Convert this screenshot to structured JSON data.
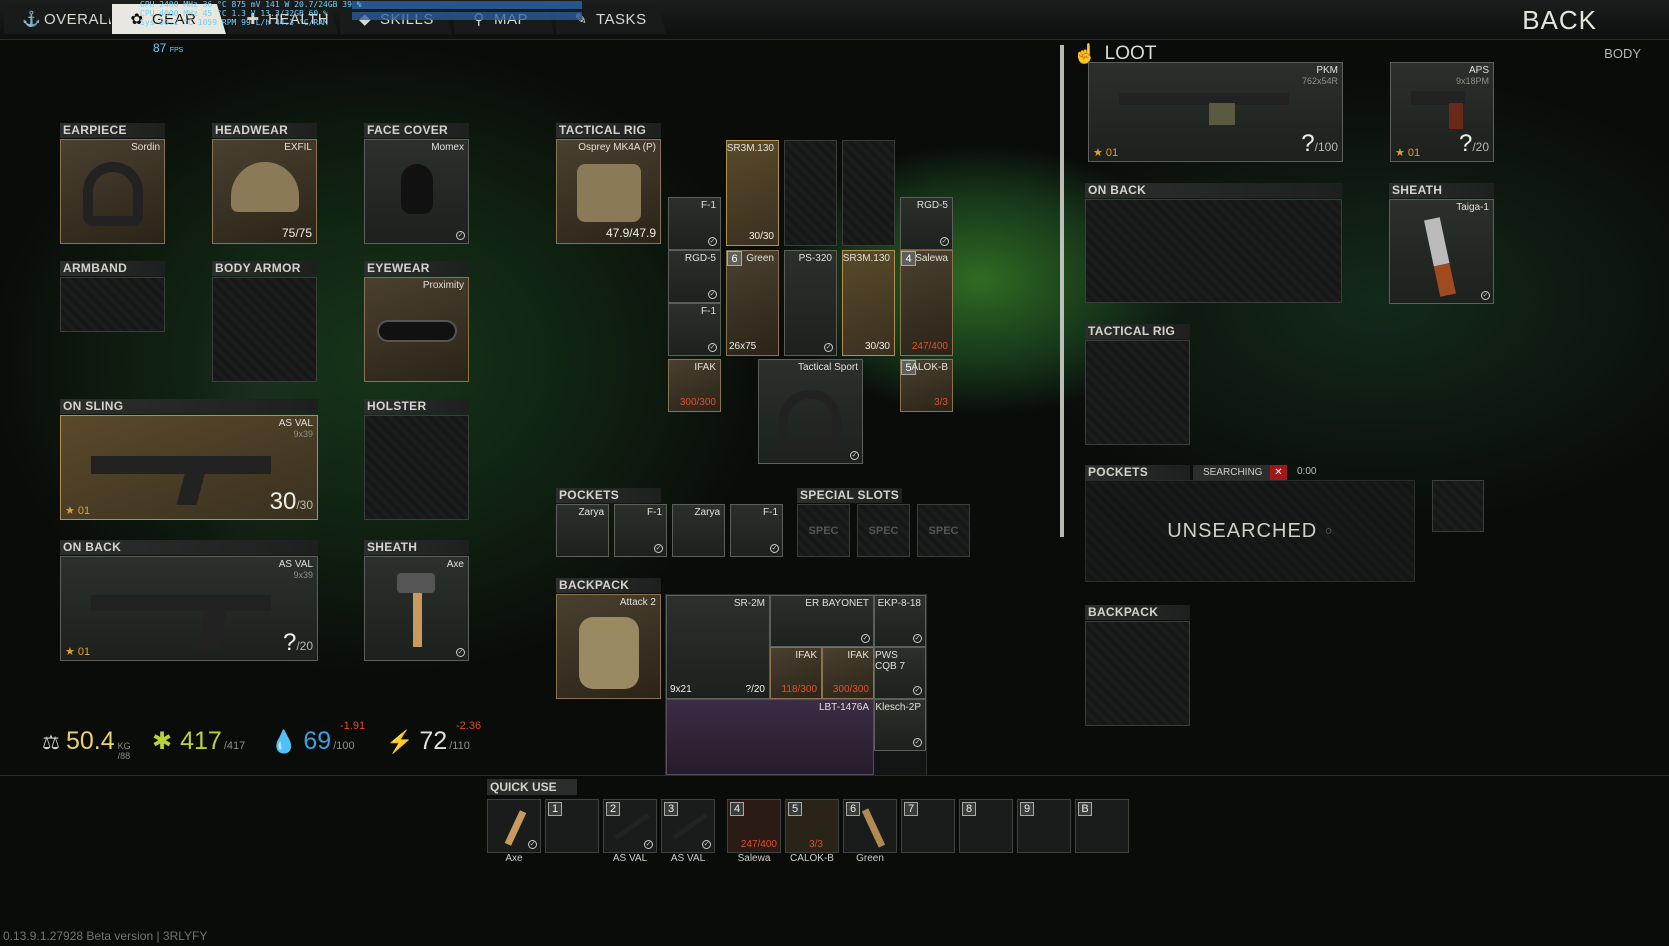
{
  "tabs": [
    {
      "label": "OVERALL",
      "icon": "anchor-icon"
    },
    {
      "label": "GEAR",
      "icon": "gear-icon"
    },
    {
      "label": "HEALTH",
      "icon": "health-icon"
    },
    {
      "label": "SKILLS",
      "icon": "skills-icon"
    },
    {
      "label": "MAP",
      "icon": "map-pin-icon"
    },
    {
      "label": "TASKS",
      "icon": "tasks-icon"
    }
  ],
  "header": {
    "back": "BACK",
    "body": "BODY",
    "loot": "LOOT"
  },
  "overlay": {
    "fps": "87",
    "fps_unit": "FPS",
    "line1": "GPU  2400 MHz  36 °C  875 mV 141 W  20.7/24GB  39 %",
    "line2": "CPU  4000 MHz  45 °C  1.3 V       13.3/32GB  60 %",
    "line3": "Sys  30.2 °C  1059 RPM  99 L/h  44.3 °C/RAM"
  },
  "equip": {
    "earpiece": {
      "header": "EARPIECE",
      "name": "Sordin"
    },
    "headwear": {
      "header": "HEADWEAR",
      "name": "EXFIL",
      "durability": "75/75"
    },
    "face_cover": {
      "header": "FACE COVER",
      "name": "Momex"
    },
    "armband": {
      "header": "ARMBAND"
    },
    "body_armor": {
      "header": "BODY ARMOR"
    },
    "eyewear": {
      "header": "EYEWEAR",
      "name": "Proximity"
    },
    "on_sling": {
      "header": "ON SLING",
      "name": "AS VAL",
      "caliber": "9x39",
      "ammo": "30",
      "ammo_max": "/30",
      "fire": "01"
    },
    "holster": {
      "header": "HOLSTER"
    },
    "on_back": {
      "header": "ON BACK",
      "name": "AS VAL",
      "caliber": "9x39",
      "ammo": "?",
      "ammo_max": "/20",
      "fire": "01"
    },
    "sheath": {
      "header": "SHEATH",
      "name": "Axe"
    }
  },
  "rig": {
    "header": "TACTICAL RIG",
    "name": "Osprey MK4A (P)",
    "durability": "47.9/47.9",
    "items": {
      "f1a": "F-1",
      "sr3m_top": "SR3M.130",
      "sr3m_top_ammo": "30/30",
      "rgd5a": "RGD-5",
      "rgd5b": "RGD-5",
      "green": "Green",
      "green_badge": "6",
      "green_cal": "26x75",
      "ps320": "PS-320",
      "sr3m_b": "SR3M.130",
      "sr3m_b_ammo": "30/30",
      "salewa": "Salewa",
      "salewa_badge": "4",
      "salewa_res": "247/400",
      "f1b": "F-1",
      "ifak": "IFAK",
      "ifak_res": "300/300",
      "tactical_sport": "Tactical Sport",
      "alok": "ALOK-B",
      "alok_badge": "5",
      "alok_res": "3/3"
    }
  },
  "pockets": {
    "header": "POCKETS",
    "items": [
      "Zarya",
      "F-1",
      "Zarya",
      "F-1"
    ]
  },
  "special": {
    "header": "SPECIAL SLOTS",
    "label": "SPEC"
  },
  "backpack": {
    "header": "BACKPACK",
    "name": "Attack 2",
    "items": {
      "sr2m": "SR-2M",
      "sr2m_cal": "9x21",
      "sr2m_ammo": "?/20",
      "bayonet": "ER BAYONET",
      "ekp": "EKP-8-18",
      "ifak1": "IFAK",
      "ifak1_res": "118/300",
      "ifak2": "IFAK",
      "ifak2_res": "300/300",
      "pws": "PWS CQB 7",
      "lbt": "LBT-1476A",
      "klesch": "Klesch-2P"
    }
  },
  "stats": {
    "weight": "50.4",
    "weight_unit": "KG",
    "weight_max": "/88",
    "health": "417",
    "health_max": "/417",
    "hydration": "69",
    "hydration_max": "/100",
    "hydration_delta": "-1.91",
    "energy": "72",
    "energy_max": "/110",
    "energy_delta": "-2.36"
  },
  "loot": {
    "weapon1": {
      "name": "PKM",
      "caliber": "762x54R",
      "ammo": "?",
      "ammo_max": "/100",
      "fire": "01"
    },
    "weapon2": {
      "name": "APS",
      "caliber": "9x18PM",
      "ammo": "?",
      "ammo_max": "/20",
      "fire": "01"
    },
    "on_back": "ON BACK",
    "sheath": "SHEATH",
    "sheath_name": "Taiga-1",
    "tactical_rig": "TACTICAL RIG",
    "pockets": "POCKETS",
    "searching": "SEARCHING",
    "timer": "0:00",
    "unsearched": "UNSEARCHED",
    "backpack": "BACKPACK"
  },
  "quick_use": {
    "header": "QUICK USE",
    "slots": [
      {
        "num": "",
        "label": "Axe"
      },
      {
        "num": "1",
        "label": ""
      },
      {
        "num": "2",
        "label": "AS VAL"
      },
      {
        "num": "3",
        "label": "AS VAL"
      },
      {
        "num": "4",
        "label": "Salewa",
        "res": "247/400"
      },
      {
        "num": "5",
        "label": "CALOK-B",
        "res": "3/3"
      },
      {
        "num": "6",
        "label": "Green"
      },
      {
        "num": "7",
        "label": ""
      },
      {
        "num": "8",
        "label": ""
      },
      {
        "num": "9",
        "label": ""
      },
      {
        "num": "B",
        "label": ""
      }
    ]
  },
  "version": "0.13.9.1.27928 Beta version | 3RLYFY"
}
